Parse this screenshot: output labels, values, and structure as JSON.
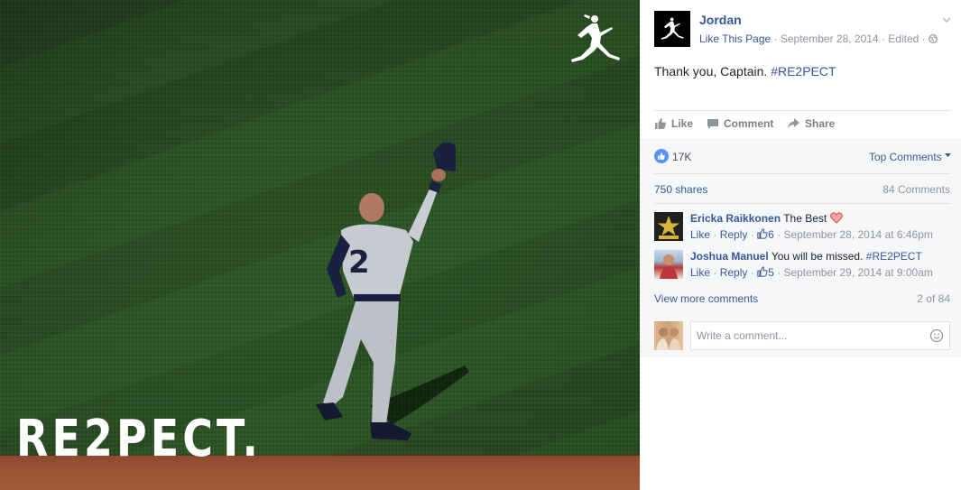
{
  "photo": {
    "overlay_text": "RE2PECT.",
    "jersey_number": "2"
  },
  "post": {
    "page_name": "Jordan",
    "like_page": "Like This Page",
    "date": "September 28, 2014",
    "edited": "Edited",
    "separator": "·",
    "text_prefix": "Thank you, Captain.",
    "hashtag": "#RE2PECT",
    "accent": "#365899"
  },
  "actions": {
    "like": "Like",
    "comment": "Comment",
    "share": "Share"
  },
  "stats": {
    "likes": "17K",
    "top_comments": "Top Comments",
    "shares": "750 shares",
    "comments_count": "84 Comments"
  },
  "comments": [
    {
      "author": "Ericka Raikkonen",
      "text": "The Best",
      "like": "Like",
      "reply": "Reply",
      "likes": "6",
      "timestamp": "September 28, 2014 at 6:46pm"
    },
    {
      "author": "Joshua Manuel",
      "text": "You will be missed.",
      "hashtag": "#RE2PECT",
      "like": "Like",
      "reply": "Reply",
      "likes": "5",
      "timestamp": "September 29, 2014 at 9:00am"
    }
  ],
  "view_more": {
    "label": "View more comments",
    "pager": "2 of 84"
  },
  "compose": {
    "placeholder": "Write a comment..."
  }
}
